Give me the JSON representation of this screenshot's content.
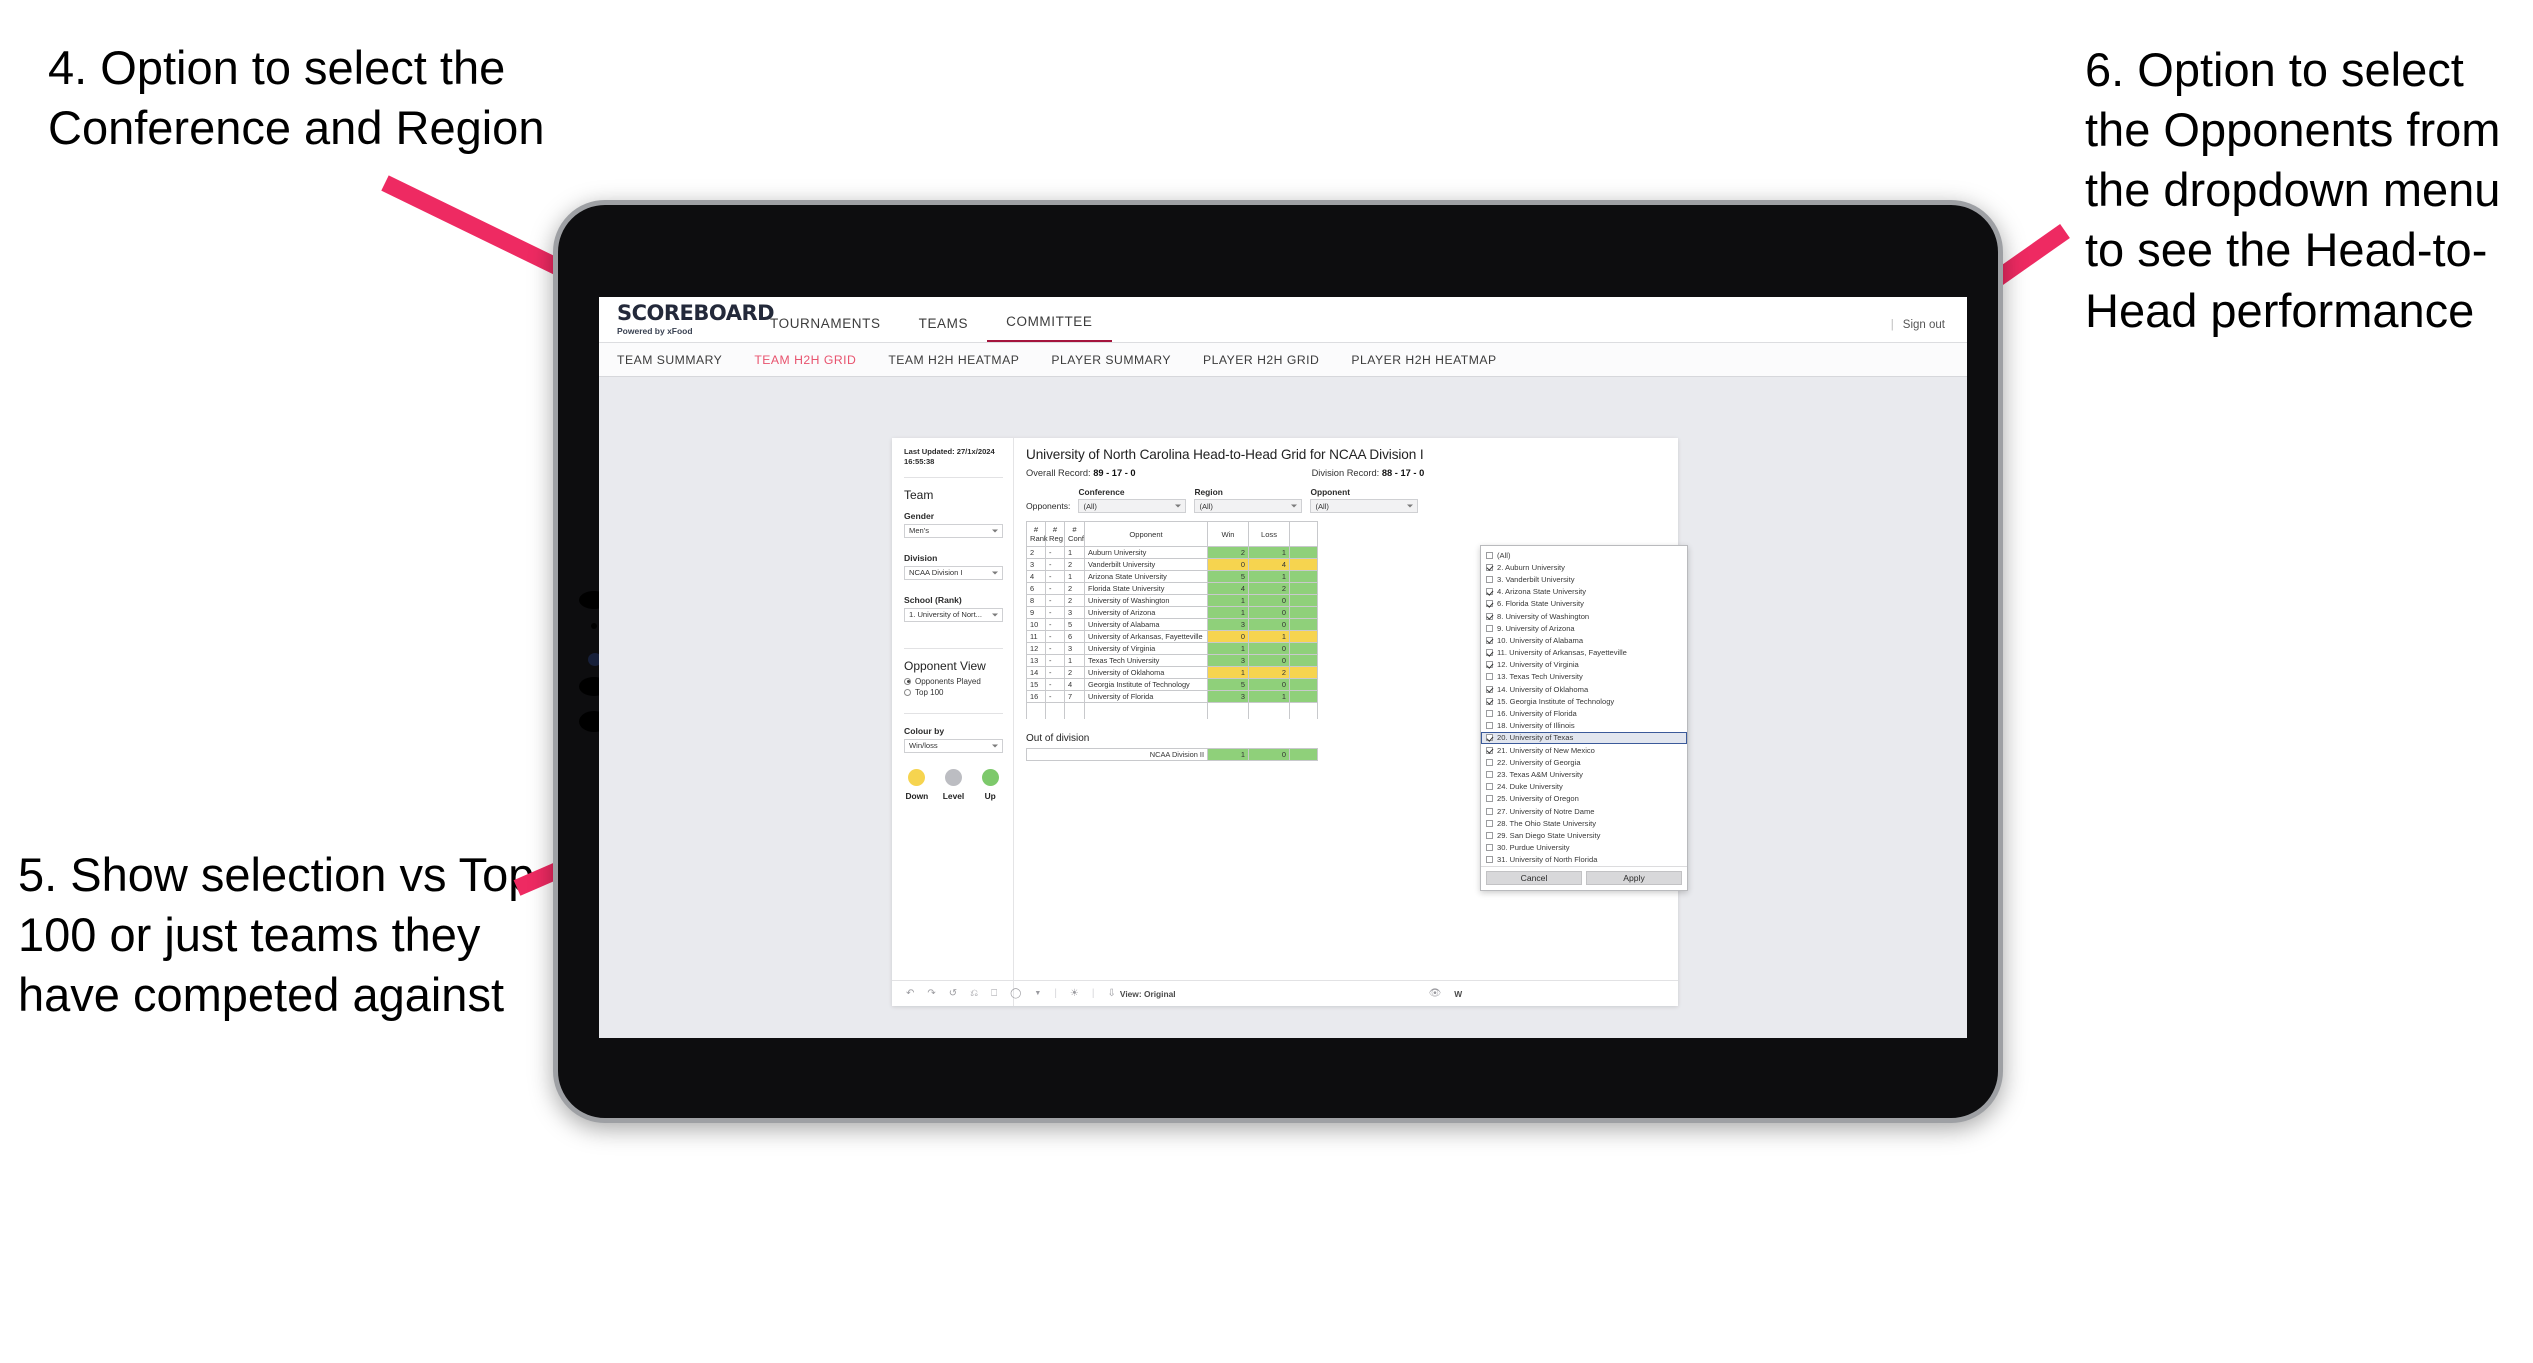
{
  "annotations": [
    {
      "id": "a4",
      "text": "4. Option to select the Conference and Region"
    },
    {
      "id": "a5",
      "text": "5. Show selection vs Top 100 or just teams they have competed against"
    },
    {
      "id": "a6",
      "text": "6. Option to select the Opponents from the dropdown menu to see the Head-to-Head performance"
    }
  ],
  "app": {
    "brand": {
      "name": "SCOREBOARD",
      "tagline": "Powered by xFood"
    },
    "topnav": [
      {
        "label": "TOURNAMENTS",
        "active": false
      },
      {
        "label": "TEAMS",
        "active": false
      },
      {
        "label": "COMMITTEE",
        "active": true
      }
    ],
    "top_right": {
      "separator": "|",
      "signout": "Sign out"
    },
    "subnav": [
      {
        "label": "TEAM SUMMARY",
        "active": false
      },
      {
        "label": "TEAM H2H GRID",
        "active": true
      },
      {
        "label": "TEAM H2H HEATMAP",
        "active": false
      },
      {
        "label": "PLAYER SUMMARY",
        "active": false
      },
      {
        "label": "PLAYER H2H GRID",
        "active": false
      },
      {
        "label": "PLAYER H2H HEATMAP",
        "active": false
      }
    ]
  },
  "left_panel": {
    "last_updated": "Last Updated: 27/1x/2024 16:55:38",
    "team_heading": "Team",
    "fields": [
      {
        "label": "Gender",
        "value": "Men's"
      },
      {
        "label": "Division",
        "value": "NCAA Division I"
      },
      {
        "label": "School (Rank)",
        "value": "1. University of Nort..."
      }
    ],
    "opponent_view": {
      "heading": "Opponent View",
      "options": [
        {
          "label": "Opponents Played",
          "selected": true
        },
        {
          "label": "Top 100",
          "selected": false
        }
      ]
    },
    "colour_by": {
      "label": "Colour by",
      "value": "Win/loss"
    },
    "legend": [
      {
        "label": "Down",
        "color": "#f6d44f"
      },
      {
        "label": "Level",
        "color": "#bcbdc2"
      },
      {
        "label": "Up",
        "color": "#7dc96b"
      }
    ]
  },
  "main": {
    "title": "University of North Carolina Head-to-Head Grid for NCAA Division I",
    "overall_record_label": "Overall Record:",
    "overall_record_value": "89 - 17 - 0",
    "division_record_label": "Division Record:",
    "division_record_value": "88 - 17 - 0",
    "filters": {
      "opponents_label": "Opponents:",
      "conference": {
        "label": "Conference",
        "value": "(All)"
      },
      "region": {
        "label": "Region",
        "value": "(All)"
      },
      "opponent": {
        "label": "Opponent",
        "value": "(All)"
      }
    },
    "table": {
      "headers": [
        "# Rank",
        "# Reg",
        "# Conf",
        "Opponent",
        "Win",
        "Loss",
        ""
      ],
      "rows": [
        {
          "rank": "2",
          "reg": "-",
          "conf": "1",
          "opponent": "Auburn University",
          "win": "2",
          "loss": "1",
          "color": "g"
        },
        {
          "rank": "3",
          "reg": "-",
          "conf": "2",
          "opponent": "Vanderbilt University",
          "win": "0",
          "loss": "4",
          "color": "y"
        },
        {
          "rank": "4",
          "reg": "-",
          "conf": "1",
          "opponent": "Arizona State University",
          "win": "5",
          "loss": "1",
          "color": "g"
        },
        {
          "rank": "6",
          "reg": "-",
          "conf": "2",
          "opponent": "Florida State University",
          "win": "4",
          "loss": "2",
          "color": "g"
        },
        {
          "rank": "8",
          "reg": "-",
          "conf": "2",
          "opponent": "University of Washington",
          "win": "1",
          "loss": "0",
          "color": "g"
        },
        {
          "rank": "9",
          "reg": "-",
          "conf": "3",
          "opponent": "University of Arizona",
          "win": "1",
          "loss": "0",
          "color": "g"
        },
        {
          "rank": "10",
          "reg": "-",
          "conf": "5",
          "opponent": "University of Alabama",
          "win": "3",
          "loss": "0",
          "color": "g"
        },
        {
          "rank": "11",
          "reg": "-",
          "conf": "6",
          "opponent": "University of Arkansas, Fayetteville",
          "win": "0",
          "loss": "1",
          "color": "y"
        },
        {
          "rank": "12",
          "reg": "-",
          "conf": "3",
          "opponent": "University of Virginia",
          "win": "1",
          "loss": "0",
          "color": "g"
        },
        {
          "rank": "13",
          "reg": "-",
          "conf": "1",
          "opponent": "Texas Tech University",
          "win": "3",
          "loss": "0",
          "color": "g"
        },
        {
          "rank": "14",
          "reg": "-",
          "conf": "2",
          "opponent": "University of Oklahoma",
          "win": "1",
          "loss": "2",
          "color": "y"
        },
        {
          "rank": "15",
          "reg": "-",
          "conf": "4",
          "opponent": "Georgia Institute of Technology",
          "win": "5",
          "loss": "0",
          "color": "g"
        },
        {
          "rank": "16",
          "reg": "-",
          "conf": "7",
          "opponent": "University of Florida",
          "win": "3",
          "loss": "1",
          "color": "g"
        }
      ]
    },
    "out_of_division": {
      "title": "Out of division",
      "rows": [
        {
          "label": "NCAA Division II",
          "win": "1",
          "loss": "0",
          "color": "g"
        }
      ]
    }
  },
  "opponent_dropdown": {
    "options": [
      {
        "label": "(All)",
        "checked": false,
        "highlight": false
      },
      {
        "label": "2. Auburn University",
        "checked": true,
        "highlight": false
      },
      {
        "label": "3. Vanderbilt University",
        "checked": false,
        "highlight": false
      },
      {
        "label": "4. Arizona State University",
        "checked": true,
        "highlight": false
      },
      {
        "label": "6. Florida State University",
        "checked": true,
        "highlight": false
      },
      {
        "label": "8. University of Washington",
        "checked": true,
        "highlight": false
      },
      {
        "label": "9. University of Arizona",
        "checked": false,
        "highlight": false
      },
      {
        "label": "10. University of Alabama",
        "checked": true,
        "highlight": false
      },
      {
        "label": "11. University of Arkansas, Fayetteville",
        "checked": true,
        "highlight": false
      },
      {
        "label": "12. University of Virginia",
        "checked": true,
        "highlight": false
      },
      {
        "label": "13. Texas Tech University",
        "checked": false,
        "highlight": false
      },
      {
        "label": "14. University of Oklahoma",
        "checked": true,
        "highlight": false
      },
      {
        "label": "15. Georgia Institute of Technology",
        "checked": true,
        "highlight": false
      },
      {
        "label": "16. University of Florida",
        "checked": false,
        "highlight": false
      },
      {
        "label": "18. University of Illinois",
        "checked": false,
        "highlight": false
      },
      {
        "label": "20. University of Texas",
        "checked": true,
        "highlight": true
      },
      {
        "label": "21. University of New Mexico",
        "checked": true,
        "highlight": false
      },
      {
        "label": "22. University of Georgia",
        "checked": false,
        "highlight": false
      },
      {
        "label": "23. Texas A&M University",
        "checked": false,
        "highlight": false
      },
      {
        "label": "24. Duke University",
        "checked": false,
        "highlight": false
      },
      {
        "label": "25. University of Oregon",
        "checked": false,
        "highlight": false
      },
      {
        "label": "27. University of Notre Dame",
        "checked": false,
        "highlight": false
      },
      {
        "label": "28. The Ohio State University",
        "checked": false,
        "highlight": false
      },
      {
        "label": "29. San Diego State University",
        "checked": false,
        "highlight": false
      },
      {
        "label": "30. Purdue University",
        "checked": false,
        "highlight": false
      },
      {
        "label": "31. University of North Florida",
        "checked": false,
        "highlight": false
      }
    ],
    "cancel_label": "Cancel",
    "apply_label": "Apply"
  },
  "toolbar": {
    "view_label": "View: Original",
    "watermark_label": "W"
  },
  "colors": {
    "accent_pink": "#ee2a62",
    "brand_red": "#a4143c",
    "active_tab": "#e8536e",
    "green": "#8fd07a",
    "yellow": "#f6d44f",
    "grey": "#bcbdc2"
  }
}
